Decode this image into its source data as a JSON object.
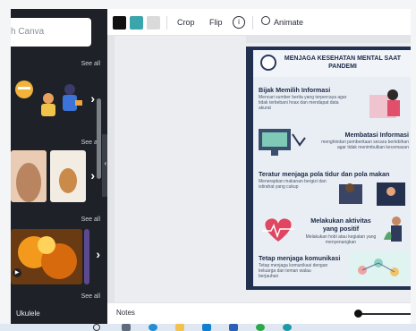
{
  "side_panel": {
    "search_placeholder": "h Canva",
    "sections": [
      {
        "see_all": "See all"
      },
      {
        "see_all": "See all"
      },
      {
        "see_all": "See all"
      },
      {
        "see_all": "See all"
      }
    ],
    "bottom_label": "Ukulele"
  },
  "toolbar": {
    "colors": [
      "#111111",
      "#3aa5aa",
      "#dadada"
    ],
    "crop_label": "Crop",
    "flip_label": "Flip",
    "info_label": "i",
    "animate_label": "Animate"
  },
  "poster": {
    "title": "MENJAGA KESEHATAN MENTAL SAAT PANDEMI",
    "sections": [
      {
        "heading": "Bijak Memilih Informasi",
        "body": "Mencari sumber berita yang terpercaya agar tidak terbebani hoax dan mendapat data akurat"
      },
      {
        "heading": "Membatasi Informasi",
        "body": "menghindari pemberitaan secara berlebihan agar tidak menimbulkan kecemasan"
      },
      {
        "heading": "Teratur menjaga pola tidur dan pola makan",
        "body": "Menerapkan makanan bergizi dan istirahat yang cukup"
      },
      {
        "heading": "Melakukan aktivitas yang positif",
        "body": "Melakukan hobi atau kegiatan yang menyenangkan"
      },
      {
        "heading": "Tetap menjaga komunikasi",
        "body": "Tetap menjaga komunikasi dengan keluarga dan teman walau berjauhan"
      }
    ]
  },
  "notes_bar": {
    "notes_label": "Notes"
  }
}
